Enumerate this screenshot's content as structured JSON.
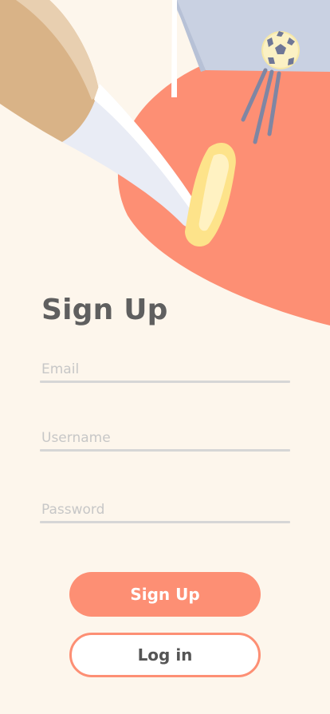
{
  "screen": {
    "title": "Sign Up"
  },
  "form": {
    "email": {
      "placeholder": "Email",
      "value": ""
    },
    "username": {
      "placeholder": "Username",
      "value": ""
    },
    "password": {
      "placeholder": "Password",
      "value": ""
    }
  },
  "actions": {
    "signup_label": "Sign Up",
    "login_label": "Log in"
  },
  "colors": {
    "background": "#fdf6ec",
    "accent": "#fd8f74",
    "heading": "#5f5f5f",
    "underline": "#d6d6d6",
    "placeholder": "#c7c7c7"
  },
  "illustration": {
    "description_icon": "soccer-kick-illustration"
  }
}
